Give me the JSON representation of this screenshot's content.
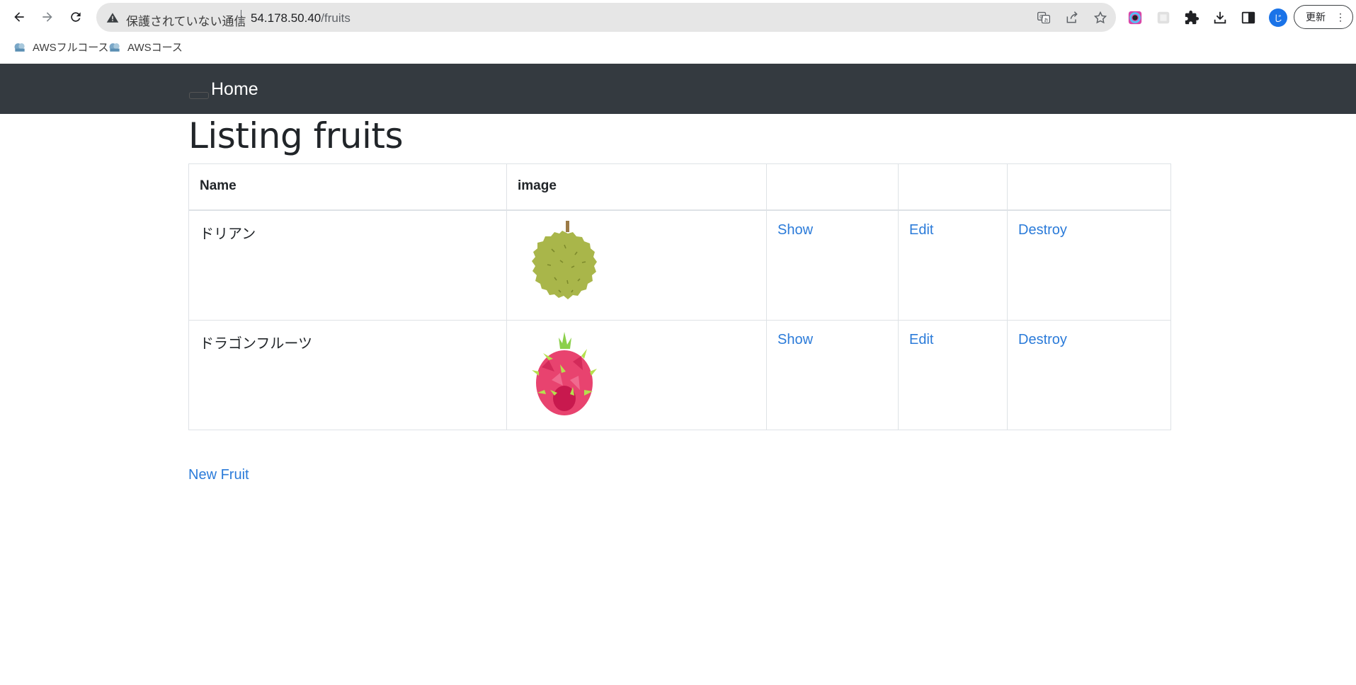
{
  "browser": {
    "omnibox": {
      "security_label": "保護されていない通信",
      "host": "54.178.50.40",
      "path": "/fruits"
    },
    "avatar_letter": "じ",
    "update_label": "更新",
    "bookmarks": [
      {
        "label": "AWSフルコース"
      },
      {
        "label": "AWSコース"
      }
    ]
  },
  "navbar": {
    "home_label": "Home"
  },
  "page": {
    "title": "Listing fruits",
    "table": {
      "headers": [
        "Name",
        "image",
        "",
        "",
        ""
      ],
      "rows": [
        {
          "name": "ドリアン",
          "image_icon": "durian-image",
          "show": "Show",
          "edit": "Edit",
          "destroy": "Destroy"
        },
        {
          "name": "ドラゴンフルーツ",
          "image_icon": "dragon-fruit-image",
          "show": "Show",
          "edit": "Edit",
          "destroy": "Destroy"
        }
      ]
    },
    "new_link": "New Fruit"
  },
  "colors": {
    "navbar_bg": "#343a40",
    "link": "#2b7bd9",
    "durian": "#a9b64a",
    "dragon_fruit": "#e8436f"
  }
}
